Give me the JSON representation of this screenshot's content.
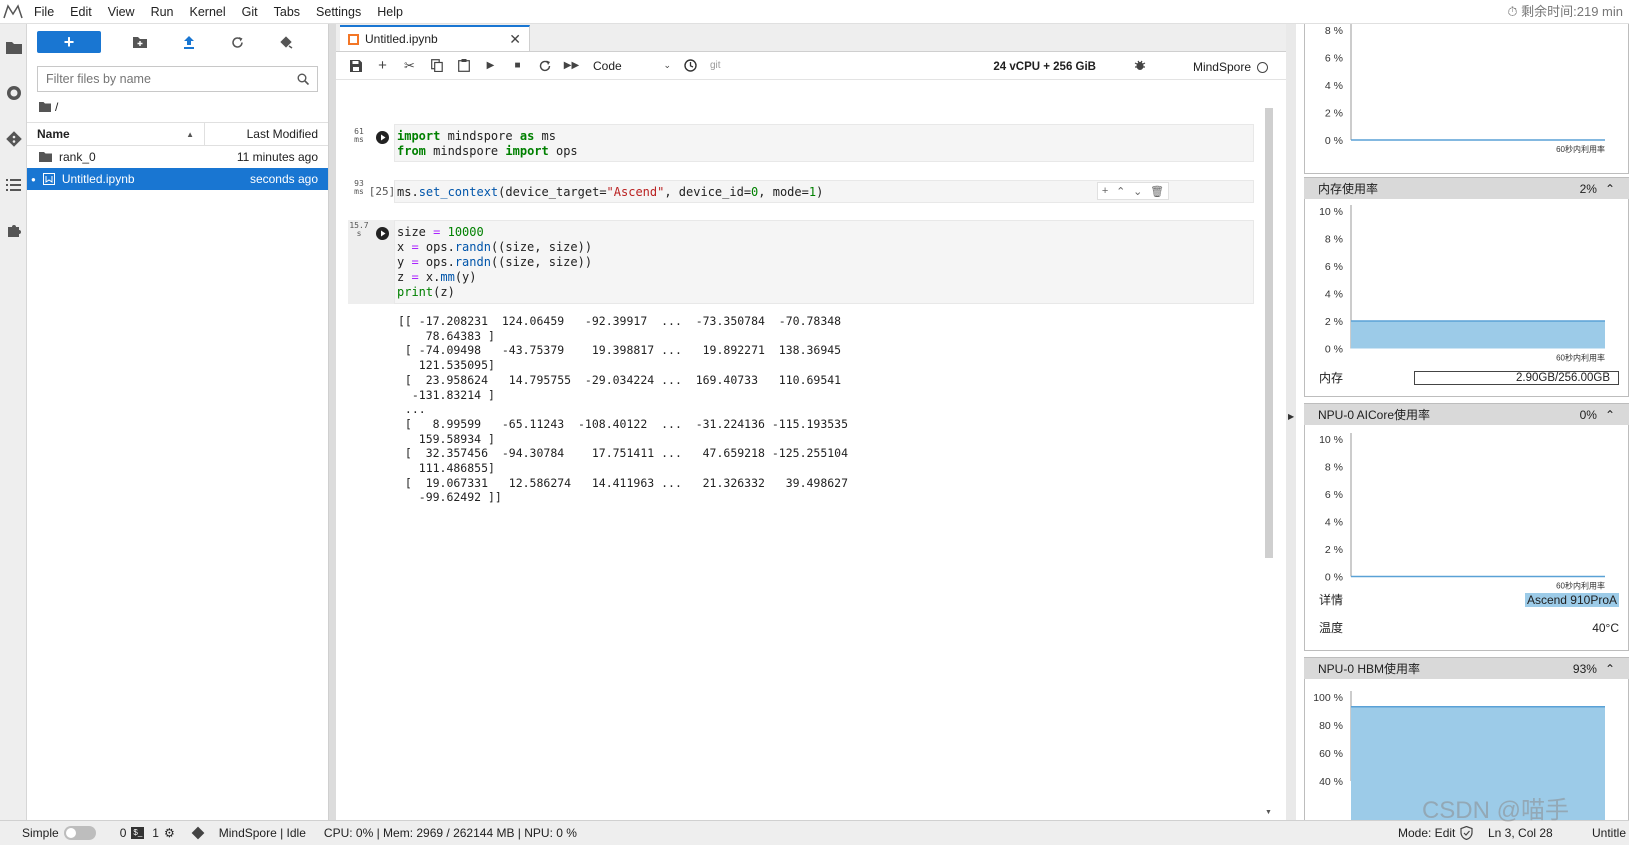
{
  "menubar": {
    "items": [
      "File",
      "Edit",
      "View",
      "Run",
      "Kernel",
      "Git",
      "Tabs",
      "Settings",
      "Help"
    ],
    "timer": "剩余时间:219 min"
  },
  "filebrowser": {
    "filter_placeholder": "Filter files by name",
    "breadcrumb": "/",
    "col_name": "Name",
    "col_modified": "Last Modified",
    "rows": [
      {
        "name": "rank_0",
        "modified": "11 minutes ago",
        "kind": "folder"
      },
      {
        "name": "Untitled.ipynb",
        "modified": "seconds ago",
        "kind": "notebook"
      }
    ]
  },
  "notebook": {
    "tab_label": "Untitled.ipynb",
    "cell_type": "Code",
    "git_label": "git",
    "resources": "24 vCPU + 256 GiB",
    "kernel": "MindSpore",
    "cells": [
      {
        "timing": "61\nms",
        "prompt": "",
        "code_html": "<span class=\"kw\">import</span> mindspore <span class=\"kw\">as</span> ms\n<span class=\"kw\">from</span> mindspore <span class=\"kw\">import</span> ops"
      },
      {
        "timing": "93\nms",
        "prompt": "[25]",
        "code_html": "ms.<span class=\"fn\">set_context</span>(device_target=<span class=\"str\">\"Ascend\"</span>, device_id=<span class=\"num\">0</span>, mode=<span class=\"num\">1</span>)"
      },
      {
        "timing": "15.7\ns",
        "prompt": "",
        "code_html": "size <span class=\"op\">=</span> <span class=\"num\">10000</span>\nx <span class=\"op\">=</span> ops.<span class=\"fn\">randn</span>((size, size))\ny <span class=\"op\">=</span> ops.<span class=\"fn\">randn</span>((size, size))\nz <span class=\"op\">=</span> x.<span class=\"fn\">mm</span>(y)\n<span class=\"kw\" style=\"font-weight:normal\">print</span>(z)"
      }
    ],
    "output": "[[ -17.208231  124.06459   -92.39917  ...  -73.350784  -70.78348\n    78.64383 ]\n [ -74.09498   -43.75379    19.398817 ...   19.892271  138.36945\n   121.535095]\n [  23.958624   14.795755  -29.034224 ...  169.40733   110.69541\n  -131.83214 ]\n ...\n [   8.99599   -65.11243  -108.40122  ...  -31.224136 -115.193535\n   159.58934 ]\n [  32.357456  -94.30784    17.751411 ...   47.659218 -125.255104\n   111.486855]\n [  19.067331   12.586274   14.411963 ...   21.326332   39.498627\n   -99.62492 ]]"
  },
  "respanel": {
    "cpu_chart": {
      "ticks": [
        "8 %",
        "6 %",
        "4 %",
        "2 %",
        "0 %"
      ],
      "footer": "60秒内利用率",
      "value_pct": 0,
      "max_pct": 10
    },
    "mem": {
      "title": "内存使用率",
      "value": "2%",
      "ticks": [
        "10 %",
        "8 %",
        "6 %",
        "4 %",
        "2 %",
        "0 %"
      ],
      "footer": "60秒内利用率",
      "value_pct": 2,
      "max_pct": 10,
      "label": "内存",
      "amount": "2.90GB/256.00GB"
    },
    "npu_aicore": {
      "title": "NPU-0 AICore使用率",
      "value": "0%",
      "ticks": [
        "10 %",
        "8 %",
        "6 %",
        "4 %",
        "2 %",
        "0 %"
      ],
      "footer": "60秒内利用率",
      "value_pct": 0,
      "max_pct": 10,
      "detail_label": "详情",
      "detail_value": "Ascend 910ProA",
      "temp_label": "温度",
      "temp_value": "40°C"
    },
    "npu_hbm": {
      "title": "NPU-0 HBM使用率",
      "value": "93%",
      "ticks": [
        "100 %",
        "80 %",
        "60 %",
        "40 %"
      ],
      "value_pct": 93,
      "max_pct": 100
    }
  },
  "statusbar": {
    "simple": "Simple",
    "terminals": "0",
    "kernels": "1",
    "kernel_status": "MindSpore | Idle",
    "usage": "CPU: 0% | Mem: 2969 / 262144 MB | NPU: 0 %",
    "mode": "Mode: Edit",
    "position": "Ln 3, Col 28",
    "filename": "Untitle"
  },
  "watermark": "CSDN @喵手",
  "colors": {
    "accent": "#1976d2",
    "chart_fill": "#9ccbe8",
    "chart_stroke": "#5aa1d6"
  }
}
